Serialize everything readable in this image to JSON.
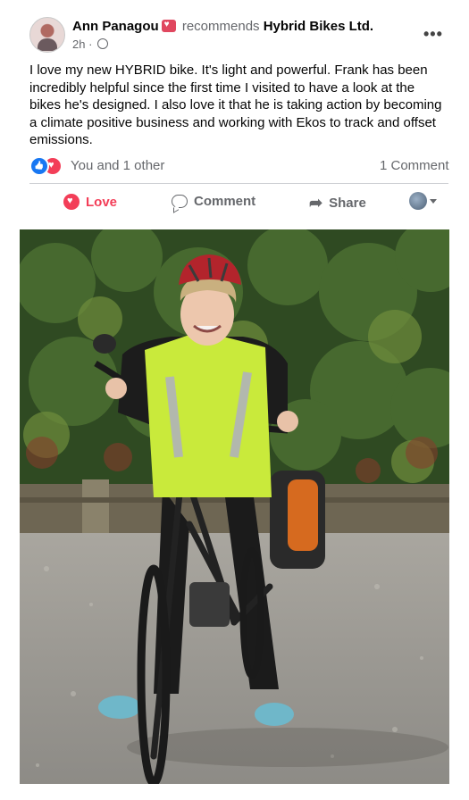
{
  "post": {
    "author": "Ann Panagou",
    "recommends_text": "recommends",
    "page_name": "Hybrid Bikes Ltd.",
    "time": "2h ·",
    "body": "I love my new HYBRID bike. It's light and powerful. Frank has been incredibly helpful since the first time I visited to have a look at the bikes he's designed. I also love it that he is taking action by becoming a climate positive business and working with Ekos to track and offset emissions."
  },
  "reactions": {
    "text": "You and 1 other",
    "comments": "1 Comment"
  },
  "actions": {
    "love": "Love",
    "comment": "Comment",
    "share": "Share"
  },
  "icons": [
    "recommend-badge-icon",
    "globe-icon",
    "more-options-icon",
    "like-reaction-icon",
    "love-reaction-icon",
    "love-icon",
    "comment-icon",
    "share-icon",
    "audience-avatar",
    "caret-down-icon"
  ],
  "colors": {
    "love_red": "#f33e58",
    "like_blue": "#1877f2",
    "secondary_text": "#65676b"
  }
}
